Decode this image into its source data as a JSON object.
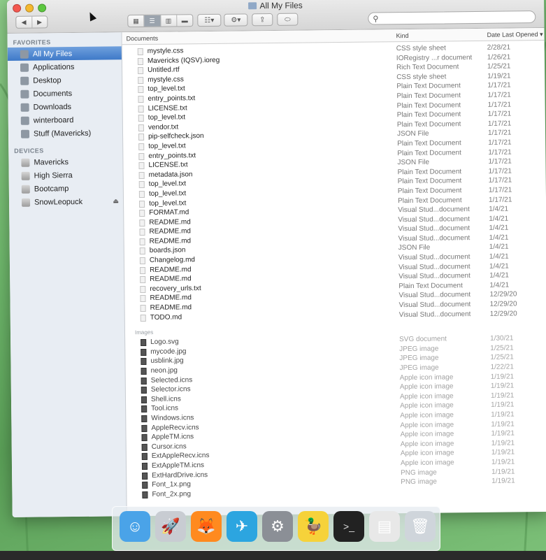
{
  "window": {
    "title": "All My Files"
  },
  "toolbar": {
    "search_placeholder": ""
  },
  "sidebar": {
    "favorites_header": "FAVORITES",
    "favorites": [
      {
        "label": "All My Files",
        "selected": true,
        "icon": "all-files-icon"
      },
      {
        "label": "Applications",
        "icon": "applications-icon"
      },
      {
        "label": "Desktop",
        "icon": "desktop-icon"
      },
      {
        "label": "Documents",
        "icon": "documents-icon"
      },
      {
        "label": "Downloads",
        "icon": "downloads-icon"
      },
      {
        "label": "winterboard",
        "icon": "home-icon"
      },
      {
        "label": "Stuff (Mavericks)",
        "icon": "folder-icon"
      }
    ],
    "devices_header": "DEVICES",
    "devices": [
      {
        "label": "Mavericks",
        "icon": "disk-icon"
      },
      {
        "label": "High Sierra",
        "icon": "disk-icon"
      },
      {
        "label": "Bootcamp",
        "icon": "disk-icon"
      },
      {
        "label": "SnowLeopuck",
        "icon": "disk-icon",
        "eject": "⏏"
      }
    ]
  },
  "columns": {
    "name": "Documents",
    "kind": "Kind",
    "date": "Date Last Opened ▾"
  },
  "documents": [
    {
      "name": "mystyle.css",
      "kind": "CSS style sheet",
      "date": "2/28/21"
    },
    {
      "name": "Mavericks (IQSV).ioreg",
      "kind": "IORegistry ...r document",
      "date": "1/26/21"
    },
    {
      "name": "Untitled.rtf",
      "kind": "Rich Text Document",
      "date": "1/25/21"
    },
    {
      "name": "mystyle.css",
      "kind": "CSS style sheet",
      "date": "1/19/21"
    },
    {
      "name": "top_level.txt",
      "kind": "Plain Text Document",
      "date": "1/17/21"
    },
    {
      "name": "entry_points.txt",
      "kind": "Plain Text Document",
      "date": "1/17/21"
    },
    {
      "name": "LICENSE.txt",
      "kind": "Plain Text Document",
      "date": "1/17/21"
    },
    {
      "name": "top_level.txt",
      "kind": "Plain Text Document",
      "date": "1/17/21"
    },
    {
      "name": "vendor.txt",
      "kind": "Plain Text Document",
      "date": "1/17/21"
    },
    {
      "name": "pip-selfcheck.json",
      "kind": "JSON File",
      "date": "1/17/21"
    },
    {
      "name": "top_level.txt",
      "kind": "Plain Text Document",
      "date": "1/17/21"
    },
    {
      "name": "entry_points.txt",
      "kind": "Plain Text Document",
      "date": "1/17/21"
    },
    {
      "name": "LICENSE.txt",
      "kind": "JSON File",
      "date": "1/17/21"
    },
    {
      "name": "metadata.json",
      "kind": "Plain Text Document",
      "date": "1/17/21"
    },
    {
      "name": "top_level.txt",
      "kind": "Plain Text Document",
      "date": "1/17/21"
    },
    {
      "name": "top_level.txt",
      "kind": "Plain Text Document",
      "date": "1/17/21"
    },
    {
      "name": "top_level.txt",
      "kind": "Plain Text Document",
      "date": "1/17/21"
    },
    {
      "name": "FORMAT.md",
      "kind": "Visual Stud...document",
      "date": "1/4/21"
    },
    {
      "name": "README.md",
      "kind": "Visual Stud...document",
      "date": "1/4/21"
    },
    {
      "name": "README.md",
      "kind": "Visual Stud...document",
      "date": "1/4/21"
    },
    {
      "name": "README.md",
      "kind": "Visual Stud...document",
      "date": "1/4/21"
    },
    {
      "name": "boards.json",
      "kind": "JSON File",
      "date": "1/4/21"
    },
    {
      "name": "Changelog.md",
      "kind": "Visual Stud...document",
      "date": "1/4/21"
    },
    {
      "name": "README.md",
      "kind": "Visual Stud...document",
      "date": "1/4/21"
    },
    {
      "name": "README.md",
      "kind": "Visual Stud...document",
      "date": "1/4/21"
    },
    {
      "name": "recovery_urls.txt",
      "kind": "Plain Text Document",
      "date": "1/4/21"
    },
    {
      "name": "README.md",
      "kind": "Visual Stud...document",
      "date": "12/29/20"
    },
    {
      "name": "README.md",
      "kind": "Visual Stud...document",
      "date": "12/29/20"
    },
    {
      "name": "TODO.md",
      "kind": "Visual Stud...document",
      "date": "12/29/20"
    }
  ],
  "images_header": "Images",
  "images": [
    {
      "name": "Logo.svg",
      "kind": "SVG document",
      "date": "1/30/21"
    },
    {
      "name": "mycode.jpg",
      "kind": "JPEG image",
      "date": "1/25/21"
    },
    {
      "name": "usblink.jpg",
      "kind": "JPEG image",
      "date": "1/25/21"
    },
    {
      "name": "neon.jpg",
      "kind": "JPEG image",
      "date": "1/22/21"
    },
    {
      "name": "Selected.icns",
      "kind": "Apple icon image",
      "date": "1/19/21"
    },
    {
      "name": "Selector.icns",
      "kind": "Apple icon image",
      "date": "1/19/21"
    },
    {
      "name": "Shell.icns",
      "kind": "Apple icon image",
      "date": "1/19/21"
    },
    {
      "name": "Tool.icns",
      "kind": "Apple icon image",
      "date": "1/19/21"
    },
    {
      "name": "Windows.icns",
      "kind": "Apple icon image",
      "date": "1/19/21"
    },
    {
      "name": "AppleRecv.icns",
      "kind": "Apple icon image",
      "date": "1/19/21"
    },
    {
      "name": "AppleTM.icns",
      "kind": "Apple icon image",
      "date": "1/19/21"
    },
    {
      "name": "Cursor.icns",
      "kind": "Apple icon image",
      "date": "1/19/21"
    },
    {
      "name": "ExtAppleRecv.icns",
      "kind": "Apple icon image",
      "date": "1/19/21"
    },
    {
      "name": "ExtAppleTM.icns",
      "kind": "Apple icon image",
      "date": "1/19/21"
    },
    {
      "name": "ExtHardDrive.icns",
      "kind": "PNG image",
      "date": "1/19/21"
    },
    {
      "name": "Font_1x.png",
      "kind": "PNG image",
      "date": "1/19/21"
    },
    {
      "name": "Font_2x.png",
      "kind": "",
      "date": ""
    }
  ],
  "dock": [
    {
      "name": "finder",
      "glyph": "☺",
      "bg": "#4aa3e8"
    },
    {
      "name": "launchpad",
      "glyph": "🚀",
      "bg": "#c8ccd2"
    },
    {
      "name": "firefox",
      "glyph": "🦊",
      "bg": "#ff8a1f"
    },
    {
      "name": "telegram",
      "glyph": "✈",
      "bg": "#2ca5e0"
    },
    {
      "name": "system-preferences",
      "glyph": "⚙",
      "bg": "#8b8f96"
    },
    {
      "name": "cyberduck",
      "glyph": "🦆",
      "bg": "#f6d23a"
    },
    {
      "name": "terminal",
      "glyph": ">_",
      "bg": "#222"
    },
    {
      "name": "document",
      "glyph": "▤",
      "bg": "#e8e8e8"
    },
    {
      "name": "trash",
      "glyph": "🗑",
      "bg": "#cfd5db"
    }
  ]
}
